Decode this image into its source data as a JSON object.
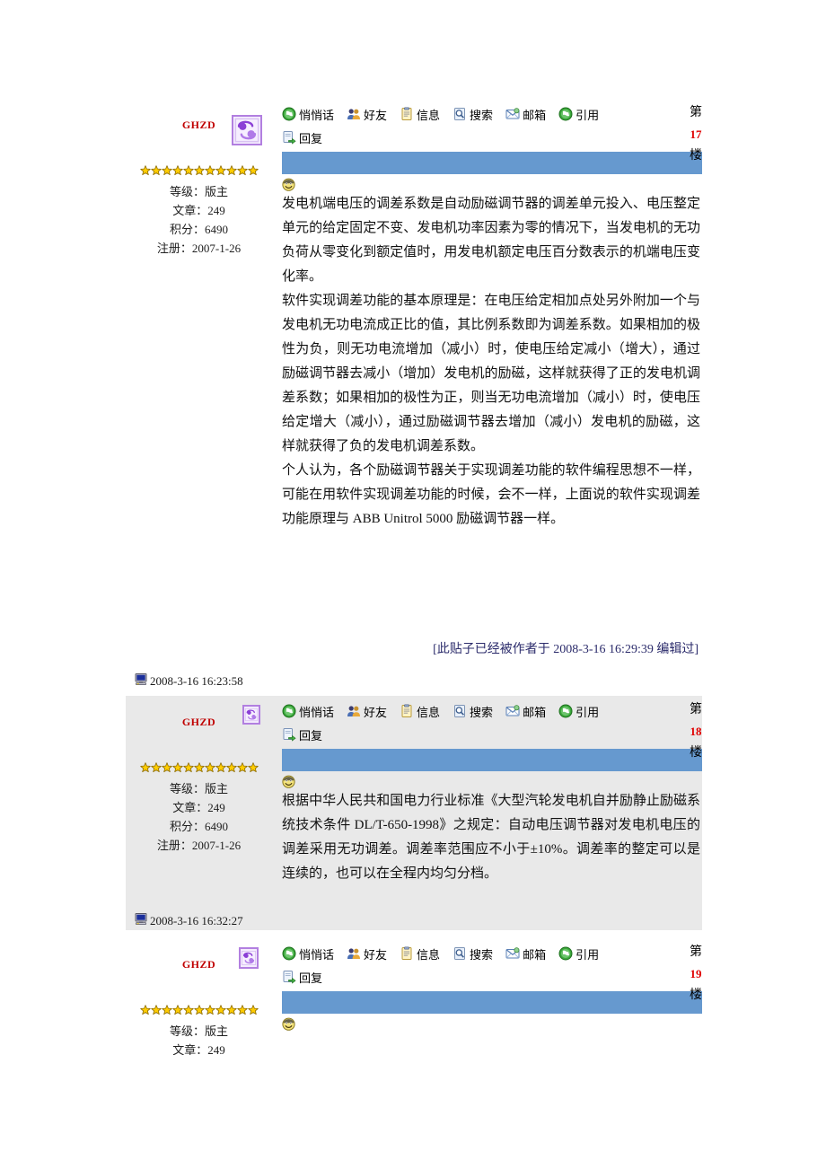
{
  "posts": [
    {
      "id": "post-17",
      "username": "GHZD",
      "avatar_icon": "zodiac-cancer-avatar",
      "stars": 11,
      "user_info": [
        {
          "label": "等级：",
          "value": "版主"
        },
        {
          "label": "文章：",
          "value": "249"
        },
        {
          "label": "积分：",
          "value": "6490"
        },
        {
          "label": "注册：",
          "value": "2007-1-26"
        }
      ],
      "toolbar_row1": [
        {
          "icon": "whisper-icon",
          "label": "悄悄话"
        },
        {
          "icon": "friends-icon",
          "label": "好友"
        },
        {
          "icon": "info-icon",
          "label": "信息"
        },
        {
          "icon": "search-icon",
          "label": "搜索"
        },
        {
          "icon": "mail-icon",
          "label": "邮箱"
        },
        {
          "icon": "quote-icon",
          "label": "引用"
        }
      ],
      "toolbar_row2": [
        {
          "icon": "reply-icon",
          "label": "回复"
        }
      ],
      "floor_prefix": "第",
      "floor_number": "17",
      "floor_suffix": "楼",
      "paragraphs": [
        "发电机端电压的调差系数是自动励磁调节器的调差单元投入、电压整定单元的给定固定不变、发电机功率因素为零的情况下，当发电机的无功负荷从零变化到额定值时，用发电机额定电压百分数表示的机端电压变化率。",
        "软件实现调差功能的基本原理是：在电压给定相加点处另外附加一个与发电机无功电流成正比的值，其比例系数即为调差系数。如果相加的极性为负，则无功电流增加（减小）时，使电压给定减小（增大），通过励磁调节器去减小（增加）发电机的励磁，这样就获得了正的发电机调差系数；如果相加的极性为正，则当无功电流增加（减小）时，使电压给定增大（减小），通过励磁调节器去增加（减小）发电机的励磁，这样就获得了负的发电机调差系数。",
        "个人认为，各个励磁调节器关于实现调差功能的软件编程思想不一样，可能在用软件实现调差功能的时候，会不一样，上面说的软件实现调差功能原理与 ABB Unitrol 5000 励磁调节器一样。"
      ],
      "edit_notice": "[此贴子已经被作者于 2008-3-16  16:29:39 编辑过]",
      "timestamp": "2008-3-16  16:23:58",
      "timestamp_icon": "computer-monitor-icon",
      "shaded": false
    },
    {
      "id": "post-18",
      "username": "GHZD",
      "avatar_icon": "zodiac-cancer-avatar",
      "stars": 11,
      "user_info": [
        {
          "label": "等级：",
          "value": "版主"
        },
        {
          "label": "文章：",
          "value": "249"
        },
        {
          "label": "积分：",
          "value": "6490"
        },
        {
          "label": "注册：",
          "value": "2007-1-26"
        }
      ],
      "toolbar_row1": [
        {
          "icon": "whisper-icon",
          "label": "悄悄话"
        },
        {
          "icon": "friends-icon",
          "label": "好友"
        },
        {
          "icon": "info-icon",
          "label": "信息"
        },
        {
          "icon": "search-icon",
          "label": "搜索"
        },
        {
          "icon": "mail-icon",
          "label": "邮箱"
        },
        {
          "icon": "quote-icon",
          "label": "引用"
        }
      ],
      "toolbar_row2": [
        {
          "icon": "reply-icon",
          "label": "回复"
        }
      ],
      "floor_prefix": "第",
      "floor_number": "18",
      "floor_suffix": "楼",
      "paragraphs": [
        "根据中华人民共和国电力行业标准《大型汽轮发电机自并励静止励磁系统技术条件 DL/T-650-1998》之规定：自动电压调节器对发电机电压的调差采用无功调差。调差率范围应不小于±10%。调差率的整定可以是连续的，也可以在全程内均匀分档。"
      ],
      "edit_notice": "",
      "timestamp": "2008-3-16  16:32:27",
      "timestamp_icon": "computer-monitor-icon",
      "shaded": true
    },
    {
      "id": "post-19",
      "username": "GHZD",
      "avatar_icon": "zodiac-cancer-avatar",
      "stars": 11,
      "user_info": [
        {
          "label": "等级：",
          "value": "版主"
        },
        {
          "label": "文章：",
          "value": "249"
        }
      ],
      "toolbar_row1": [
        {
          "icon": "whisper-icon",
          "label": "悄悄话"
        },
        {
          "icon": "friends-icon",
          "label": "好友"
        },
        {
          "icon": "info-icon",
          "label": "信息"
        },
        {
          "icon": "search-icon",
          "label": "搜索"
        },
        {
          "icon": "mail-icon",
          "label": "邮箱"
        },
        {
          "icon": "quote-icon",
          "label": "引用"
        }
      ],
      "toolbar_row2": [
        {
          "icon": "reply-icon",
          "label": "回复"
        }
      ],
      "floor_prefix": "第",
      "floor_number": "19",
      "floor_suffix": "楼",
      "paragraphs": [],
      "edit_notice": "",
      "timestamp": "",
      "timestamp_icon": "computer-monitor-icon",
      "shaded": false
    }
  ],
  "colors": {
    "username": "#c00000",
    "floor_number": "#e00000",
    "blue_bar": "#6699cf",
    "shaded_bg": "#e9e9e9",
    "edit_notice": "#2b2b6b",
    "star": "#ffcc00",
    "avatar_border": "#b27fe0"
  }
}
